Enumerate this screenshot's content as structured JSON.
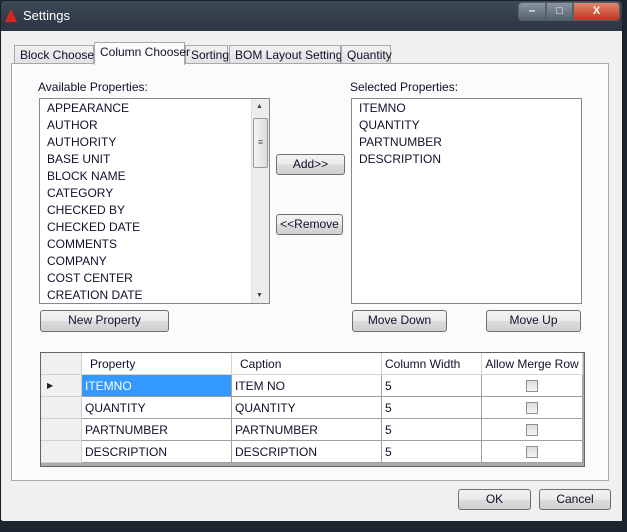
{
  "window": {
    "title": "Settings",
    "controls": {
      "minimize": "–",
      "maximize": "□",
      "close": "X"
    }
  },
  "tabs": [
    {
      "label": "Block Chooser"
    },
    {
      "label": "Column Chooser",
      "selected": true
    },
    {
      "label": "Sorting"
    },
    {
      "label": "BOM Layout Settings"
    },
    {
      "label": "Quantity"
    }
  ],
  "available": {
    "label": "Available Properties:",
    "items": [
      "APPEARANCE",
      "AUTHOR",
      "AUTHORITY",
      "BASE UNIT",
      "BLOCK NAME",
      "CATEGORY",
      "CHECKED BY",
      "CHECKED DATE",
      "COMMENTS",
      "COMPANY",
      "COST CENTER",
      "CREATION DATE"
    ]
  },
  "selected": {
    "label": "Selected Properties:",
    "items": [
      "ITEMNO",
      "QUANTITY",
      "PARTNUMBER",
      "DESCRIPTION"
    ]
  },
  "buttons": {
    "add": "Add>>",
    "remove": "<<Remove",
    "new_property": "New Property",
    "move_down": "Move Down",
    "move_up": "Move Up",
    "ok": "OK",
    "cancel": "Cancel"
  },
  "grid": {
    "headers": [
      "Property",
      "Caption",
      "Column Width",
      "Allow Merge Row"
    ],
    "rows": [
      {
        "property": "ITEMNO",
        "caption": "ITEM NO",
        "width": "5",
        "merge": false
      },
      {
        "property": "QUANTITY",
        "caption": "QUANTITY",
        "width": "5",
        "merge": false
      },
      {
        "property": "PARTNUMBER",
        "caption": "PARTNUMBER",
        "width": "5",
        "merge": false
      },
      {
        "property": "DESCRIPTION",
        "caption": "DESCRIPTION",
        "width": "5",
        "merge": false
      }
    ]
  },
  "colors": {
    "selection": "#3399ff",
    "titlebar": "#3e4a58"
  }
}
